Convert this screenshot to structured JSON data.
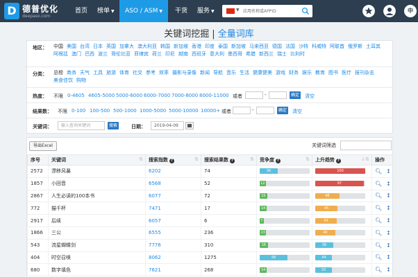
{
  "header": {
    "logo_mark": "D",
    "logo_cn": "德普优化",
    "logo_en": "deepaso.com",
    "nav": [
      {
        "label": "首页"
      },
      {
        "label": "榜单"
      },
      {
        "label": "ASO / ASM"
      },
      {
        "label": "干货"
      },
      {
        "label": "服务"
      }
    ],
    "search_placeholder": "应用名称或APPID",
    "lang_label": "中",
    "colors": {
      "bar": "#2c3e50",
      "active": "#1e9be6"
    }
  },
  "page": {
    "title": "关键词挖掘",
    "separator": "|",
    "subtitle": "全量词库"
  },
  "filters": {
    "region": {
      "label": "地区：",
      "items": [
        "中国",
        "美国",
        "台湾",
        "日本",
        "英国",
        "加拿大",
        "澳大利亚",
        "韩国",
        "新加坡",
        "香港",
        "印度",
        "泰国",
        "新加坡",
        "马来西亚",
        "德国",
        "法国",
        "沙特",
        "科威特",
        "阿联酋",
        "俄罗斯",
        "土耳其",
        "阿根廷",
        "澳门",
        "巴西",
        "波兰",
        "哥伦比亚",
        "菲律宾",
        "荷兰",
        "印尼",
        "越南",
        "西班牙",
        "意大利",
        "墨西哥",
        "希腊",
        "新西兰",
        "瑞士",
        "比利时"
      ],
      "selected": "中国"
    },
    "category": {
      "label": "分类：",
      "items": [
        "总榜",
        "商务",
        "天气",
        "工具",
        "旅游",
        "体育",
        "社交",
        "参考",
        "效率",
        "摄影与录像",
        "新闻",
        "导航",
        "音乐",
        "生活",
        "健康健美",
        "游戏",
        "财务",
        "娱乐",
        "教育",
        "图书",
        "医疗",
        "报刊杂志",
        "美食佳饮",
        "购物"
      ],
      "selected": "总榜"
    },
    "heat": {
      "label": "热度：",
      "options": [
        "不限",
        "0-4605",
        "4605-5000",
        "5000-6000",
        "6000-7000",
        "7000-8000",
        "8000-11000"
      ],
      "or_label": "或者",
      "dash": "-",
      "ok_label": "确定",
      "clear_label": "清空"
    },
    "results": {
      "label": "结果数：",
      "options": [
        "不限",
        "0-100",
        "100-500",
        "500-1000",
        "1000-5000",
        "5000-10000",
        "10000+"
      ],
      "or_label": "或者",
      "dash": "-",
      "ok_label": "确定",
      "clear_label": "清空"
    },
    "keyword": {
      "label": "关键词：",
      "placeholder": "输入查询关键词",
      "search_label": "搜索",
      "date_label": "日期：",
      "date_value": "2019-04-09"
    }
  },
  "table": {
    "export_label": "导出Excel",
    "filter_label": "关键词筛选",
    "headers": {
      "seq": "序号",
      "keyword": "关键词",
      "index": "搜索指数",
      "results": "搜索结果数",
      "competition": "竞争度",
      "trend": "上升趋势",
      "ops": "操作"
    },
    "rows": [
      {
        "seq": "2572",
        "keyword": "漂移风暴",
        "index": "6202",
        "results": "74",
        "comp": 36,
        "comp_label": "36",
        "trend": 100,
        "trend_label": "100",
        "trend_color": "#d9534f"
      },
      {
        "seq": "1857",
        "keyword": "小回音",
        "index": "6568",
        "results": "52",
        "comp": 12,
        "comp_label": "12",
        "trend": 97,
        "trend_label": "97",
        "trend_color": "#d9534f"
      },
      {
        "seq": "2867",
        "keyword": "人生必读的100本书",
        "index": "6077",
        "results": "72",
        "comp": 15,
        "comp_label": "15",
        "trend": 48,
        "trend_label": "48",
        "trend_color": "#f0ad4e"
      },
      {
        "seq": "772",
        "keyword": "猫千杯",
        "index": "7471",
        "results": "17",
        "comp": 14,
        "comp_label": "14",
        "trend": 45,
        "trend_label": "45",
        "trend_color": "#f0ad4e"
      },
      {
        "seq": "2917",
        "keyword": "后续",
        "index": "6057",
        "results": "6",
        "comp": 7,
        "comp_label": "7",
        "trend": 43,
        "trend_label": "43",
        "trend_color": "#f0ad4e"
      },
      {
        "seq": "1866",
        "keyword": "三公",
        "index": "6555",
        "results": "236",
        "comp": 13,
        "comp_label": "13",
        "trend": 40,
        "trend_label": "40",
        "trend_color": "#f0ad4e"
      },
      {
        "seq": "543",
        "keyword": "流星蝴蝶剑",
        "index": "7776",
        "results": "310",
        "comp": 16,
        "comp_label": "16",
        "trend": 36,
        "trend_label": "36",
        "trend_color": "#5bc0de"
      },
      {
        "seq": "404",
        "keyword": "时空召唤",
        "index": "8062",
        "results": "1275",
        "comp": 56,
        "comp_label": "56",
        "trend": 34,
        "trend_label": "34",
        "trend_color": "#5bc0de"
      },
      {
        "seq": "680",
        "keyword": "数字填色",
        "index": "7621",
        "results": "268",
        "comp": 14,
        "comp_label": "14",
        "trend": 33,
        "trend_label": "33",
        "trend_color": "#5bc0de"
      }
    ]
  }
}
